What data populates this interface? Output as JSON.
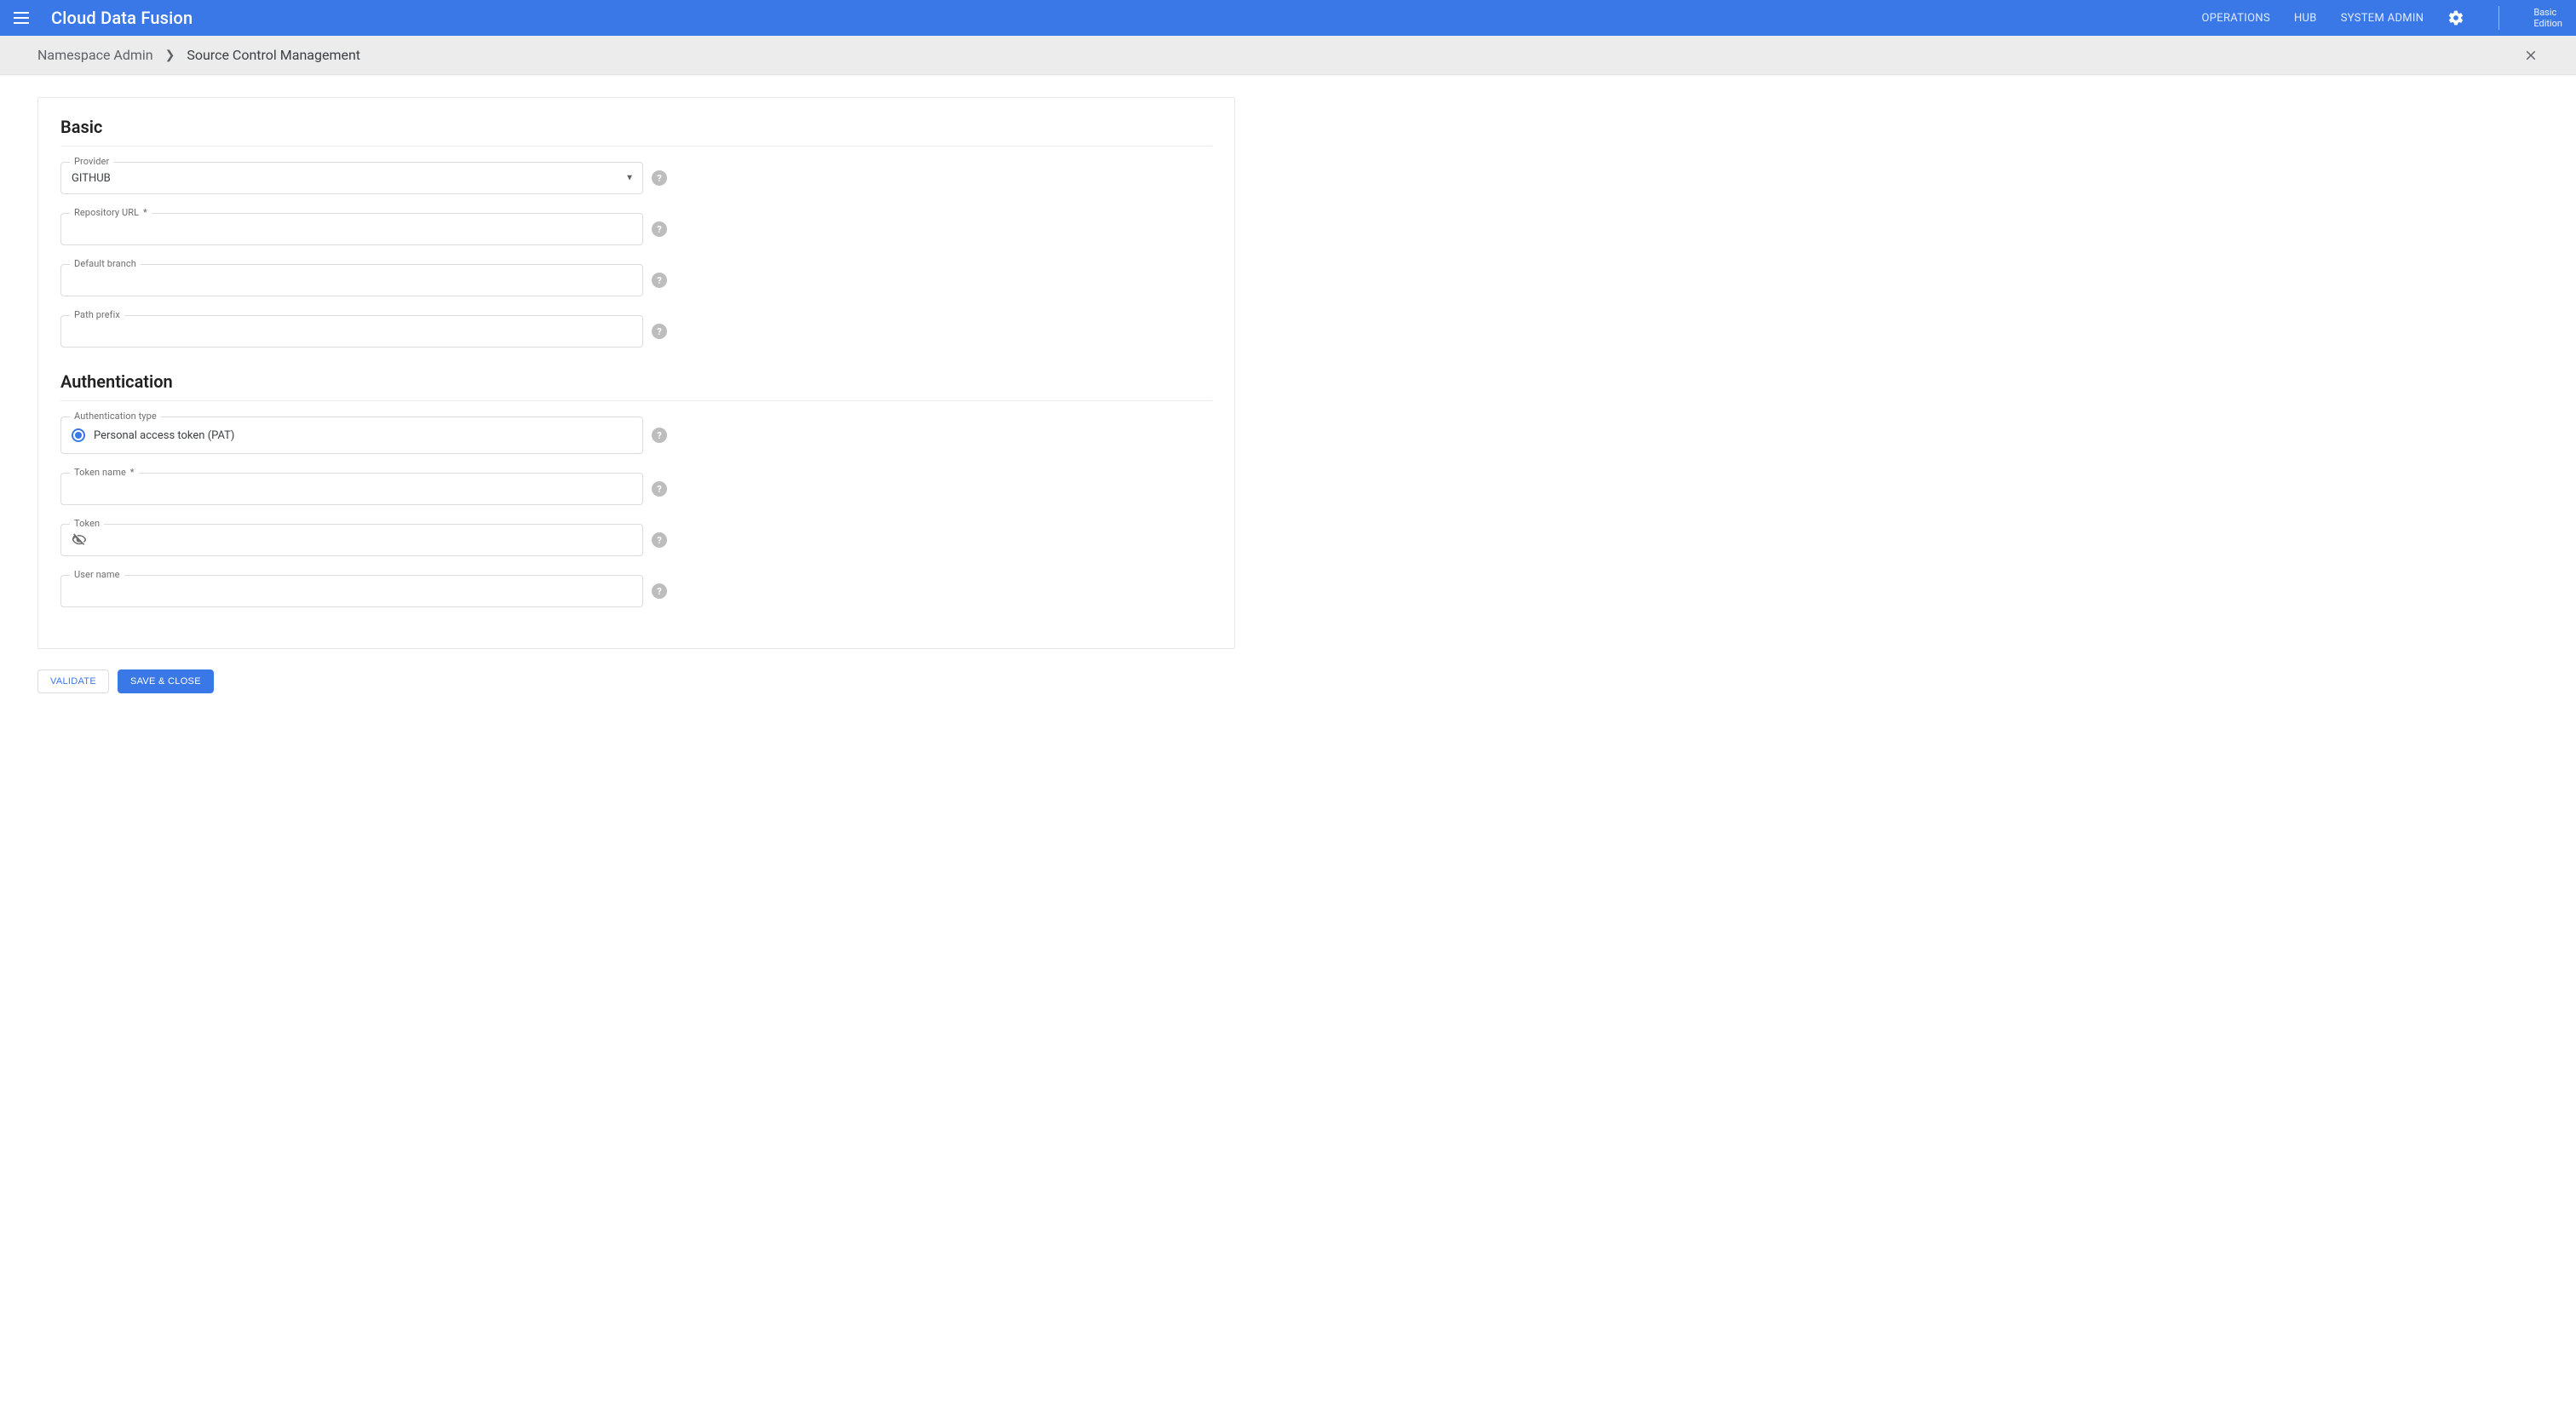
{
  "header": {
    "app_title": "Cloud Data Fusion",
    "nav": {
      "operations": "OPERATIONS",
      "hub": "HUB",
      "system_admin": "SYSTEM ADMIN"
    },
    "edition_line1": "Basic",
    "edition_line2": "Edition"
  },
  "breadcrumb": {
    "level1": "Namespace Admin",
    "level2": "Source Control Management"
  },
  "sections": {
    "basic": {
      "title": "Basic",
      "provider": {
        "label": "Provider",
        "value": "GITHUB"
      },
      "repo_url": {
        "label": "Repository URL",
        "value": ""
      },
      "default_branch": {
        "label": "Default branch",
        "value": ""
      },
      "path_prefix": {
        "label": "Path prefix",
        "value": ""
      }
    },
    "auth": {
      "title": "Authentication",
      "auth_type": {
        "label": "Authentication type",
        "option": "Personal access token (PAT)"
      },
      "token_name": {
        "label": "Token name",
        "value": ""
      },
      "token": {
        "label": "Token",
        "value": ""
      },
      "user_name": {
        "label": "User name",
        "value": ""
      }
    }
  },
  "buttons": {
    "validate": "VALIDATE",
    "save": "SAVE & CLOSE"
  },
  "required_marker": "*"
}
